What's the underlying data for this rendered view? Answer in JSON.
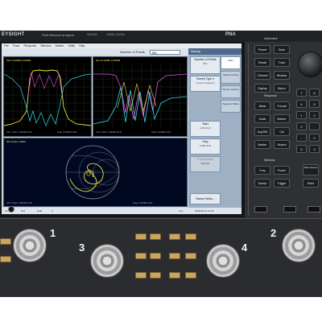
{
  "header": {
    "brand": "EYSIGHT",
    "model": "PNA Network Analyzer",
    "model_code": "N5224B",
    "freq": "10MHz-43GHz",
    "series": "PNA"
  },
  "screen": {
    "menu": [
      "File",
      "Trace",
      "Response",
      "Stimulus",
      "Marker",
      "Utility",
      "Help"
    ],
    "number_of_points_label": "Number of Points",
    "number_of_points_value": "801",
    "softkey_menu_title": "Sweep",
    "softkeys": [
      {
        "label": "Number of Points",
        "value": "801"
      },
      {
        "label": "Sweep Type",
        "value": "Linear Frequency"
      },
      {
        "label": "Start",
        "value": "1.000 GHz"
      },
      {
        "label": "Stop",
        "value": "2.000 GHz"
      },
      {
        "label": "IF Bandwidth",
        "value": "100 kHz"
      },
      {
        "label": "Sweep Setup..."
      }
    ],
    "right_keys": [
      "Main",
      "Sweep Timing",
      "Source Control",
      "Segment Table"
    ],
    "trace_labels": {
      "p1": "S21 10.00dB/ 0.000dB",
      "p2": "S11 10.00dB/ 0.000dB",
      "p3": "S11 Smith 1.000U"
    },
    "channel_footers": {
      "p1_start": "Ch1: Start 1.00000 GHz",
      "p1_stop": "Stop 2.00000 GHz",
      "p2_start": "Ch1: Start 1.00000 GHz",
      "p2_stop": "Stop 2.00000 GHz",
      "p3_start": "Ch1: Start 1.00000 GHz",
      "p3_stop": "Stop 2.00000 GHz"
    },
    "status": {
      "channel": "Ch 1",
      "meas": "S11",
      "sweep": "Hold",
      "cal": "C",
      "lcl": "LCL",
      "time": "2018-02-14 11:26"
    }
  },
  "panel": {
    "instrument_label": "Instrument",
    "instrument_keys": [
      "Preset",
      "Save",
      "Recall",
      "Trace",
      "Channel",
      "Window",
      "Display",
      "Macro"
    ],
    "response_label": "Response",
    "response_keys": [
      "Meas",
      "Format",
      "Scale",
      "Marker",
      "Avg BW",
      "Cal",
      "Marker",
      "Search"
    ],
    "stimulus_label": "Stimulus",
    "stimulus_keys": [
      "Freq",
      "Power",
      "Sweep",
      "Trigger"
    ],
    "num_keys": [
      "7",
      "8",
      "9",
      "4",
      "5",
      "6",
      "1",
      "2",
      "3",
      "0",
      ".",
      "-"
    ],
    "entry_keys": [
      "Back Space",
      "Enter"
    ],
    "ports": [
      "1",
      "2",
      "3",
      "4"
    ]
  }
}
